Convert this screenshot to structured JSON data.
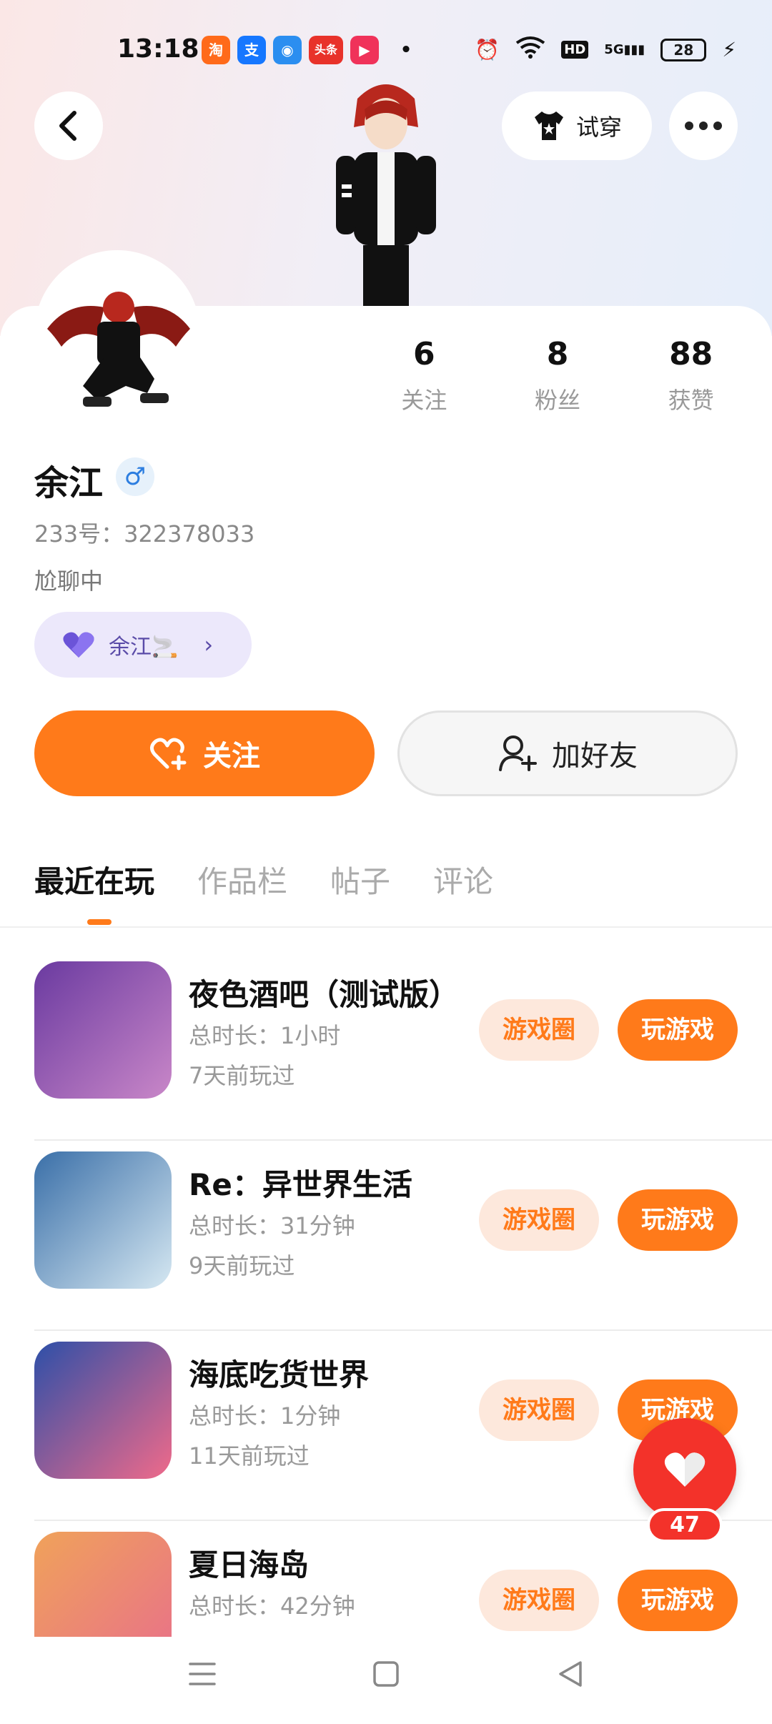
{
  "status_bar": {
    "time": "13:18",
    "apps": [
      {
        "icon": "taobao-icon",
        "color": "#ff6a1a",
        "glyph": "淘"
      },
      {
        "icon": "alipay-icon",
        "color": "#1677ff",
        "glyph": "支"
      },
      {
        "icon": "browser-icon",
        "color": "#2b8ef0",
        "glyph": "◉"
      },
      {
        "icon": "toutiao-icon",
        "color": "#e8322a",
        "glyph": "头条"
      },
      {
        "icon": "video-icon",
        "color": "#f0325a",
        "glyph": "▶"
      }
    ],
    "network": "5G",
    "hd": "HD",
    "battery": "28"
  },
  "header": {
    "try_on_label": "试穿"
  },
  "profile": {
    "stats": [
      {
        "value": "6",
        "label": "关注"
      },
      {
        "value": "8",
        "label": "粉丝"
      },
      {
        "value": "88",
        "label": "获赞"
      }
    ],
    "name": "余江",
    "gender_symbol": "♂",
    "uid": "233号：322378033",
    "bio": "尬聊中",
    "tag_label": "余江🚬"
  },
  "actions": {
    "follow_label": "关注",
    "add_friend_label": "加好友"
  },
  "tabs": [
    "最近在玩",
    "作品栏",
    "帖子",
    "评论"
  ],
  "games": [
    {
      "name": "夜色酒吧（测试版）",
      "duration": "总时长：1小时",
      "last_played": "7天前玩过",
      "circle_label": "游戏圈",
      "play_label": "玩游戏",
      "icon_colors": [
        "#6a3aa0",
        "#c987c8"
      ]
    },
    {
      "name": "Re：异世界生活",
      "duration": "总时长：31分钟",
      "last_played": "9天前玩过",
      "circle_label": "游戏圈",
      "play_label": "玩游戏",
      "icon_colors": [
        "#3a6fa8",
        "#d6e8f2"
      ]
    },
    {
      "name": "海底吃货世界",
      "duration": "总时长：1分钟",
      "last_played": "11天前玩过",
      "circle_label": "游戏圈",
      "play_label": "玩游戏",
      "icon_colors": [
        "#2d4fa8",
        "#f06a8a"
      ]
    },
    {
      "name": "夏日海岛",
      "duration": "总时长：42分钟",
      "last_played": "",
      "circle_label": "游戏圈",
      "play_label": "玩游戏",
      "icon_colors": [
        "#f0a25a",
        "#e8708a"
      ]
    }
  ],
  "like_fab": {
    "count": "47"
  },
  "colors": {
    "accent": "#ff7a1a",
    "like": "#f3322a"
  }
}
